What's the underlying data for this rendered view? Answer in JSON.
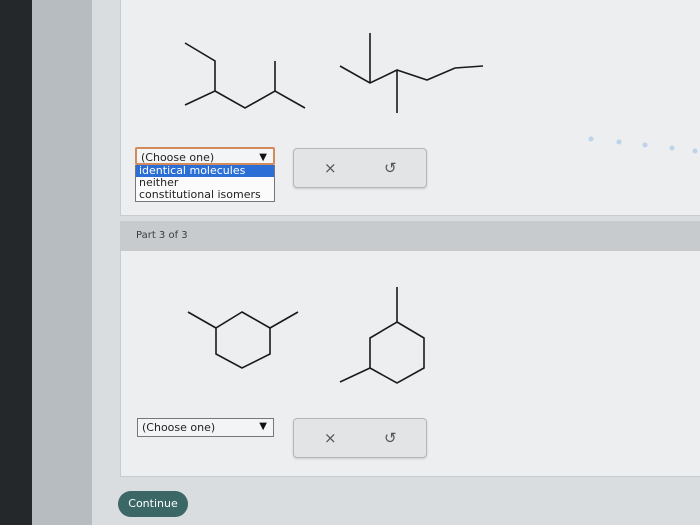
{
  "question1": {
    "dropdown": {
      "selected": "(Choose one)",
      "options": [
        "identical molecules",
        "neither",
        "constitutional isomers"
      ],
      "highlighted_index": 0
    },
    "tools": {
      "clear": "×",
      "undo": "↺"
    }
  },
  "part3": {
    "label": "Part 3 of 3",
    "dropdown": {
      "selected": "(Choose one)"
    },
    "tools": {
      "clear": "×",
      "undo": "↺"
    }
  },
  "footer": {
    "continue_label": "Continue"
  },
  "colors": {
    "highlight": "#2b6fd6",
    "continue_bg": "#3c6767",
    "focus_border": "#d18b5c"
  }
}
